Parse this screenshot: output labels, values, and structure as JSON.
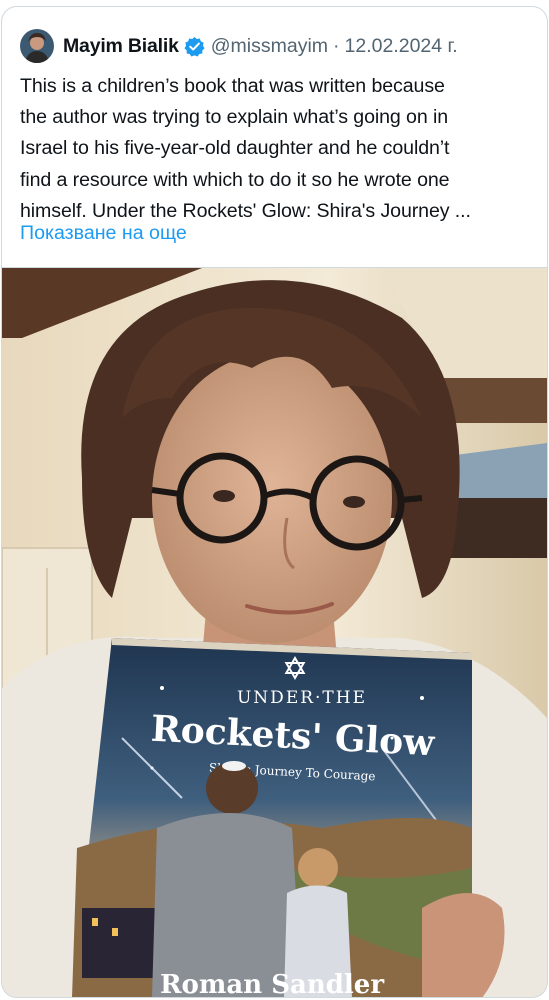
{
  "tweet": {
    "author_name": "Mayim Bialik",
    "handle": "@missmayim",
    "separator": "·",
    "date": "12.02.2024 г.",
    "text": "This is a children’s book that was written because\nthe author was trying to explain what’s going on in\nIsrael to his five-year-old daughter and he couldn’t\nfind a resource with which to do it so he wrote one\nhimself. Under the Rockets' Glow: Shira's Journey ...",
    "show_more_label": "Показване на още",
    "accent_color": "#1d9bf0"
  },
  "icons": {
    "verified": "verified-badge-icon",
    "avatar": "avatar"
  },
  "media": {
    "book": {
      "line1": "UNDER·THE",
      "title": "Rockets' Glow",
      "subtitle": "Shira's Journey To Courage",
      "author": "Roman Sandler"
    }
  }
}
